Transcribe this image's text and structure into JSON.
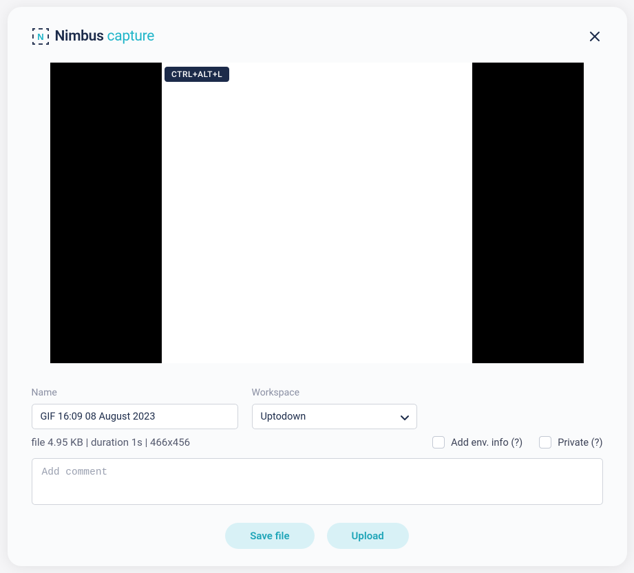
{
  "brand": {
    "nimbus": "Nimbus",
    "capture": " capture"
  },
  "shortcut": "CTRL+ALT+L",
  "form": {
    "name_label": "Name",
    "name_value": "GIF 16:09 08 August 2023",
    "workspace_label": "Workspace",
    "workspace_value": "Uptodown"
  },
  "file_info": "file 4.95 KB | duration 1s | 466x456",
  "checks": {
    "env_label": "Add env. info (?)",
    "private_label": "Private (?)"
  },
  "comment_placeholder": "Add comment",
  "actions": {
    "save": "Save file",
    "upload": "Upload"
  }
}
